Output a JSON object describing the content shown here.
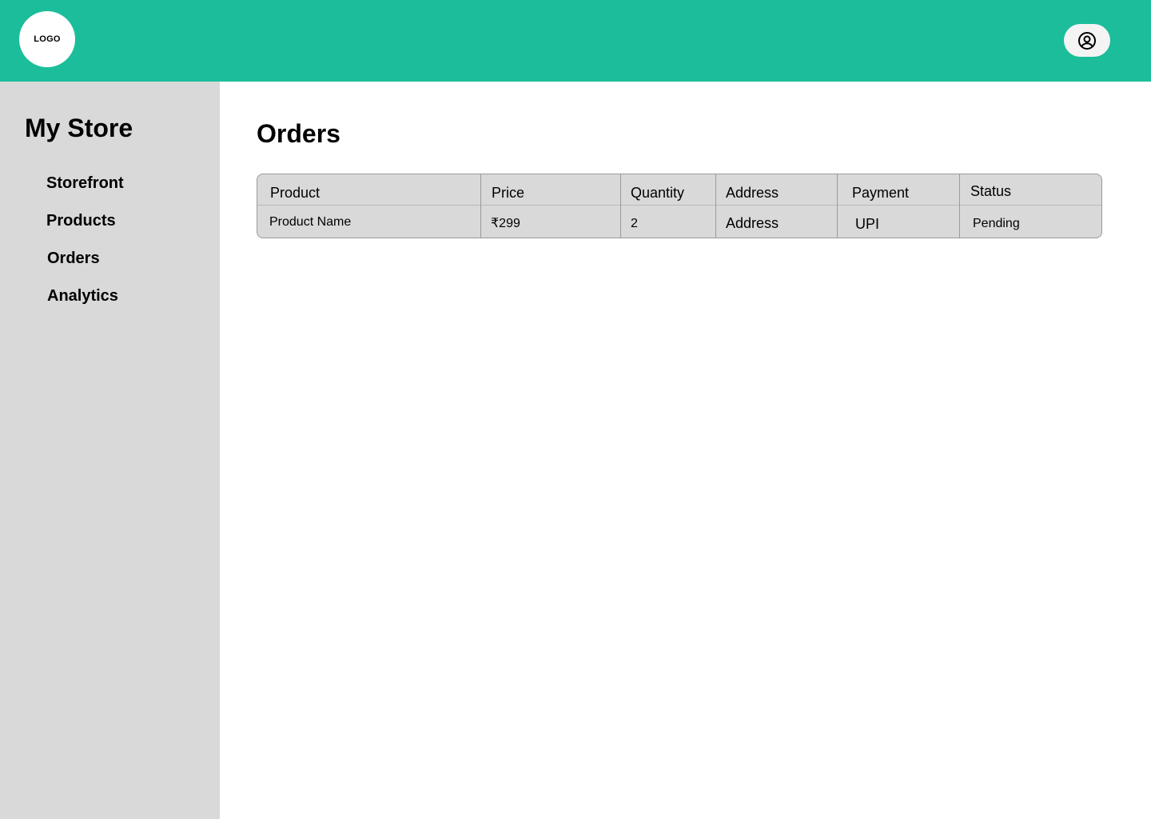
{
  "header": {
    "logo_text": "LOGO",
    "profile_icon": "user-circle-icon",
    "brand_color": "#1cbd9b"
  },
  "sidebar": {
    "store_name": "My Store",
    "items": [
      {
        "label": "Storefront"
      },
      {
        "label": "Products"
      },
      {
        "label": "Orders"
      },
      {
        "label": "Analytics"
      }
    ]
  },
  "main": {
    "title": "Orders",
    "table": {
      "columns": [
        "Product",
        "Price",
        "Quantity",
        "Address",
        "Payment",
        "Status"
      ],
      "rows": [
        {
          "product": "Product Name",
          "price": "₹299",
          "quantity": "2",
          "address": "Address",
          "payment": "UPI",
          "status": "Pending"
        }
      ]
    }
  }
}
